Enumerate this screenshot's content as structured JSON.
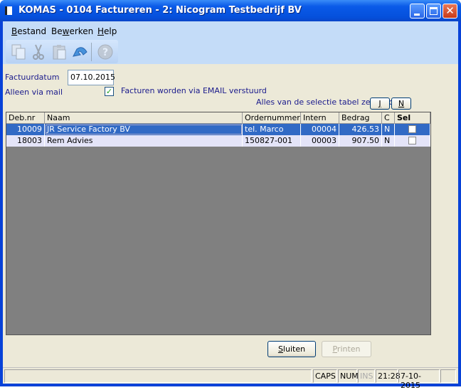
{
  "window": {
    "title": "KOMAS - 0104 Factureren - 2: Nicogram Testbedrijf BV"
  },
  "menu": {
    "items": [
      {
        "label": "Bestand",
        "accel": "B",
        "rest": "estand"
      },
      {
        "label": "Bewerken",
        "pre": "Be",
        "accel": "w",
        "rest": "erken"
      },
      {
        "label": "Help",
        "accel": "H",
        "rest": "elp"
      }
    ]
  },
  "toolbar": {
    "icons": [
      "copy-icon",
      "cut-icon",
      "paste-icon",
      "undo-icon",
      "help-icon"
    ]
  },
  "form": {
    "factuurdatum_label": "Factuurdatum",
    "factuurdatum_value": "07.10.2015",
    "alleen_mail_label": "Alleen via mail",
    "alleen_mail_checked": true,
    "email_text": "Facturen worden via EMAIL verstuurd",
    "select_all_label": "Alles van de selectie tabel zetten op",
    "j_label": "J",
    "n_label": "N"
  },
  "table": {
    "columns": [
      "Deb.nr",
      "Naam",
      "Ordernummer",
      "Intern",
      "Bedrag",
      "C",
      "Sel"
    ],
    "rows": [
      {
        "debnr": "10009",
        "naam": "JR Service Factory BV",
        "order": "tel. Marco",
        "intern": "00004",
        "bedrag": "426.53",
        "c": "N",
        "sel": false
      },
      {
        "debnr": "18003",
        "naam": "Rem Advies",
        "order": "150827-001",
        "intern": "00003",
        "bedrag": "907.50",
        "c": "N",
        "sel": false
      }
    ]
  },
  "buttons": {
    "sluiten": "Sluiten",
    "printen": "Printen"
  },
  "status": {
    "caps": "CAPS",
    "num": "NUM",
    "ins": "INS",
    "time": "21:28",
    "date": "7-10-2015"
  },
  "colors": {
    "selection": "#316ac5",
    "title_bar": "#0a5ae8",
    "label_text": "#1a1a8c"
  }
}
